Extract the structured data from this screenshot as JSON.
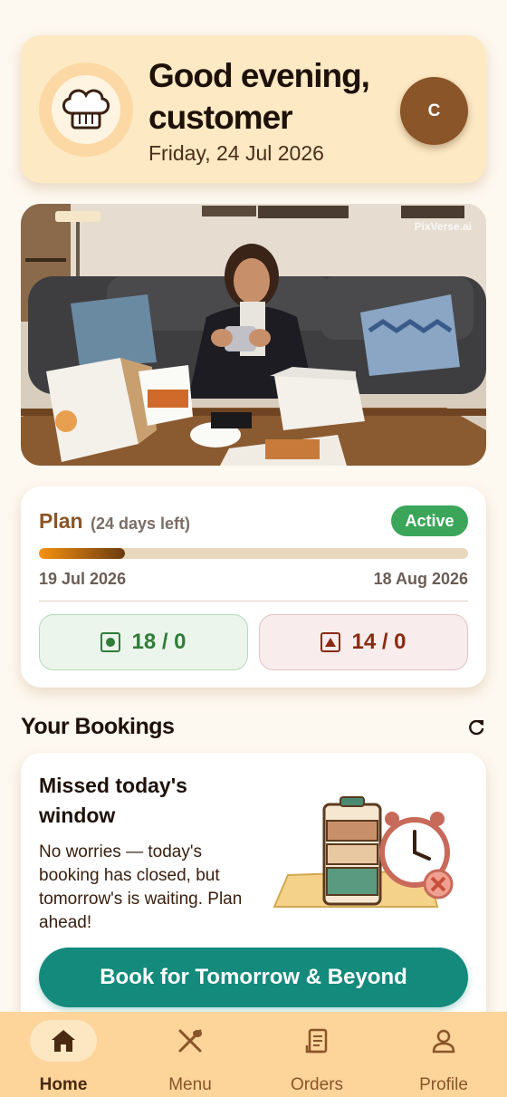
{
  "header": {
    "greeting_line1": "Good evening,",
    "greeting_line2": "customer",
    "date": "Friday, 24 Jul 2026",
    "avatar_initial": "C",
    "chef_icon": "chef-hat-icon"
  },
  "hero": {
    "watermark": "PixVerse.ai"
  },
  "plan": {
    "title": "Plan",
    "days_left": "(24 days left)",
    "status": "Active",
    "progress": 0.2,
    "start_date": "19 Jul 2026",
    "end_date": "18 Aug 2026",
    "veg_count": "18 / 0",
    "nonveg_count": "14 / 0",
    "colors": {
      "veg": "#2f7d38",
      "nonveg": "#8a2a10",
      "active": "#3ba65a"
    }
  },
  "bookings": {
    "section_title": "Your Bookings",
    "refresh_icon": "refresh-icon",
    "card_title": "Missed today's window",
    "card_body": "No worries — today's booking has closed, but tomorrow's is waiting. Plan ahead!",
    "cta_label": "Book for Tomorrow & Beyond",
    "cta_color": "#138a7c"
  },
  "nav": {
    "items": [
      {
        "label": "Home",
        "icon": "home-icon",
        "active": true
      },
      {
        "label": "Menu",
        "icon": "utensils-icon",
        "active": false
      },
      {
        "label": "Orders",
        "icon": "receipt-icon",
        "active": false
      },
      {
        "label": "Profile",
        "icon": "user-icon",
        "active": false
      }
    ]
  }
}
